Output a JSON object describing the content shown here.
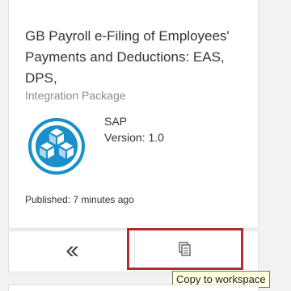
{
  "package": {
    "title": "GB Payroll e-Filing of Employees' Payments and Deductions: EAS, DPS,",
    "type": "Integration Package",
    "vendor": "SAP",
    "version": "Version: 1.0",
    "published": "Published: 7 minutes ago",
    "logo_icon": "integration-package-icon"
  },
  "actions": {
    "deploy_icon": "deploy-icon",
    "copy_icon": "copy-document-icon",
    "copy_tooltip": "Copy to workspace"
  },
  "colors": {
    "accent": "#1a8fc9",
    "highlight_border": "#b02a2f",
    "tooltip_bg": "#ffffe1"
  }
}
